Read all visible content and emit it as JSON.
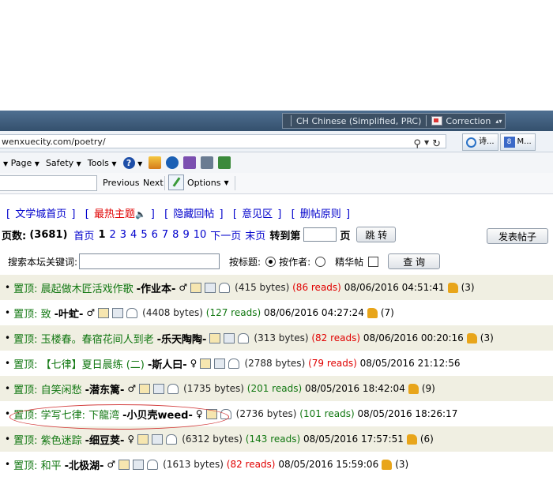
{
  "ime": {
    "language": "CH Chinese (Simplified, PRC)",
    "correction": "Correction"
  },
  "address": {
    "url": "wenxuecity.com/poetry/"
  },
  "tabs": [
    {
      "label": "诗..."
    },
    {
      "label": "M..."
    }
  ],
  "commandbar": {
    "page": "Page",
    "safety": "Safety",
    "tools": "Tools"
  },
  "findbar": {
    "previous": "Previous",
    "next": "Next",
    "options": "Options"
  },
  "topnav": {
    "items": [
      "文学城首页",
      "最热主题",
      "隐藏回帖",
      "意见区",
      "删帖原则"
    ]
  },
  "pager": {
    "label": "页数:",
    "count": "(3681)",
    "first": "首页",
    "current": "1",
    "pages": [
      "2",
      "3",
      "4",
      "5",
      "6",
      "7",
      "8",
      "9",
      "10"
    ],
    "next": "下一页",
    "last": "末页",
    "goto": "转到第",
    "page_unit": "页",
    "jump": "跳 转",
    "post": "发表帖子"
  },
  "search": {
    "label": "搜索本坛关键词:",
    "by_title": "按标题:",
    "by_author": "按作者:",
    "featured": "精华帖",
    "button": "查 询"
  },
  "posts": [
    {
      "title": "置顶: 晨起做木匠活戏作歌",
      "author": "-作业本-",
      "gender": "♂",
      "bytes": "(415 bytes)",
      "reads": "(86 reads)",
      "reads_color": "red",
      "datetime": "08/06/2016  04:51:41",
      "likes": "(3)"
    },
    {
      "title": "置顶: 致",
      "author": "-叶虻-",
      "gender": "♂",
      "bytes": "(4408 bytes)",
      "reads": "(127 reads)",
      "reads_color": "green",
      "datetime": "08/06/2016  04:27:24",
      "likes": "(7)"
    },
    {
      "title": "置顶: 玉楼春。春宿花间人到老",
      "author": "-乐天陶陶-",
      "gender": "",
      "bytes": "(313 bytes)",
      "reads": "(82 reads)",
      "reads_color": "red",
      "datetime": "08/06/2016  00:20:16",
      "likes": "(3)"
    },
    {
      "title": "置顶: 【七律】夏日晨练 (二)",
      "author": "-斯人曰-",
      "gender": "♀",
      "bytes": "(2788 bytes)",
      "reads": "(79 reads)",
      "reads_color": "red",
      "datetime": "08/05/2016  21:12:56",
      "likes": ""
    },
    {
      "title": "置顶: 自笑闲愁",
      "author": "-潜东篱-",
      "gender": "♂",
      "bytes": "(1735 bytes)",
      "reads": "(201 reads)",
      "reads_color": "green",
      "datetime": "08/05/2016  18:42:04",
      "likes": "(9)"
    },
    {
      "title": "置顶: 学写七律:  下龍湾",
      "author": "-小贝壳weed-",
      "gender": "♀",
      "bytes": "(2736 bytes)",
      "reads": "(101 reads)",
      "reads_color": "green",
      "datetime": "08/05/2016  18:26:17",
      "likes": ""
    },
    {
      "title": "置顶: 紫色迷踪",
      "author": "-细豆荚-",
      "gender": "♀",
      "bytes": "(6312 bytes)",
      "reads": "(143 reads)",
      "reads_color": "green",
      "datetime": "08/05/2016  17:57:51",
      "likes": "(6)"
    },
    {
      "title": "置顶: 和平",
      "author": "-北极湖-",
      "gender": "♂",
      "bytes": "(1613 bytes)",
      "reads": "(82 reads)",
      "reads_color": "red",
      "datetime": "08/05/2016  15:59:06",
      "likes": "(3)"
    }
  ]
}
